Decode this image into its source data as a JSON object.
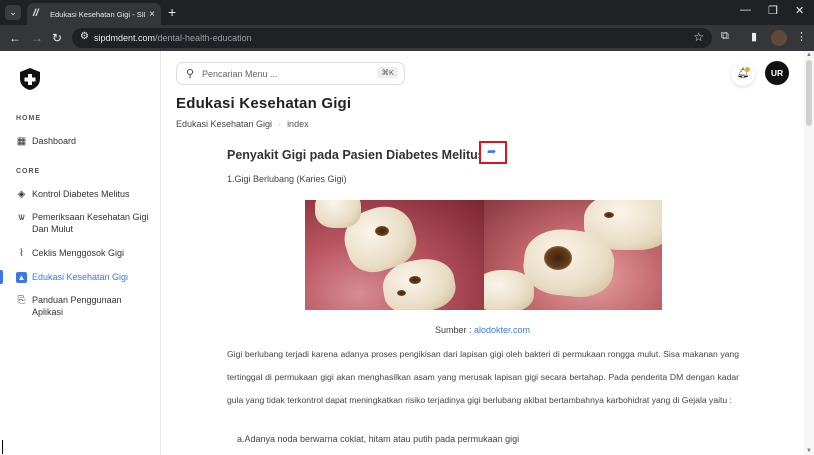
{
  "browser": {
    "tab_title": "Edukasi Kesehatan Gigi - SIP DM",
    "tab_favicon": "//",
    "new_tab": "+",
    "tab_menu": "⌄",
    "close_tab": "×",
    "minimize": "—",
    "restore": "❐",
    "close_window": "✕",
    "url_domain": "sipdmdent.com",
    "url_path": "/dental-health-education",
    "profile_menu": "⋮"
  },
  "sidebar": {
    "sections": [
      {
        "label": "HOME"
      },
      {
        "label": "CORE"
      }
    ],
    "items": [
      {
        "label": "Dashboard",
        "icon": "dashboard-icon"
      },
      {
        "label": "Kontrol Diabetes Melitus",
        "icon": "droplet-icon"
      },
      {
        "label": "Pemeriksaan Kesehatan Gigi Dan Mulut",
        "icon": "tooth-icon"
      },
      {
        "label": "Ceklis Menggosok Gigi",
        "icon": "toothbrush-icon"
      },
      {
        "label": "Edukasi Kesehatan Gigi",
        "icon": "education-icon",
        "active": true
      },
      {
        "label": "Panduan Penggunaan Aplikasi",
        "icon": "guide-icon"
      }
    ]
  },
  "header": {
    "search_placeholder": "Pencarian Menu ...",
    "search_shortcut": "⌘K",
    "user_initials": "UR"
  },
  "page": {
    "title": "Edukasi Kesehatan Gigi",
    "breadcrumb": [
      "Edukasi Kesehatan Gigi",
      "index"
    ]
  },
  "article": {
    "title": "Penyakit Gigi pada Pasien Diabetes Melitus",
    "subheading": "1.Gigi Berlubang (Karies Gigi)",
    "source_label": "Sumber : ",
    "source_link": "alodokter.com",
    "paragraph": "Gigi berlubang terjadi karena adanya proses pengikisan dari lapisan gigi oleh bakteri di permukaan rongga mulut. Sisa makanan yang tertinggal di permukaan gigi akan menghasilkan asam yang merusak lapisan gigi secara bertahap. Pada penderita DM dengan kadar gula yang tidak terkontrol dapat meningkatkan risiko terjadinya gigi berlubang akibat bertambahnya karbohidrat yang di Gejala yaitu :",
    "list_item": "a.Adanya noda berwarna coklat, hitam atau putih pada permukaan gigi"
  },
  "colors": {
    "accent": "#3b78e7",
    "highlight_box": "#e0121b",
    "notification_dot": "#f5a623"
  }
}
